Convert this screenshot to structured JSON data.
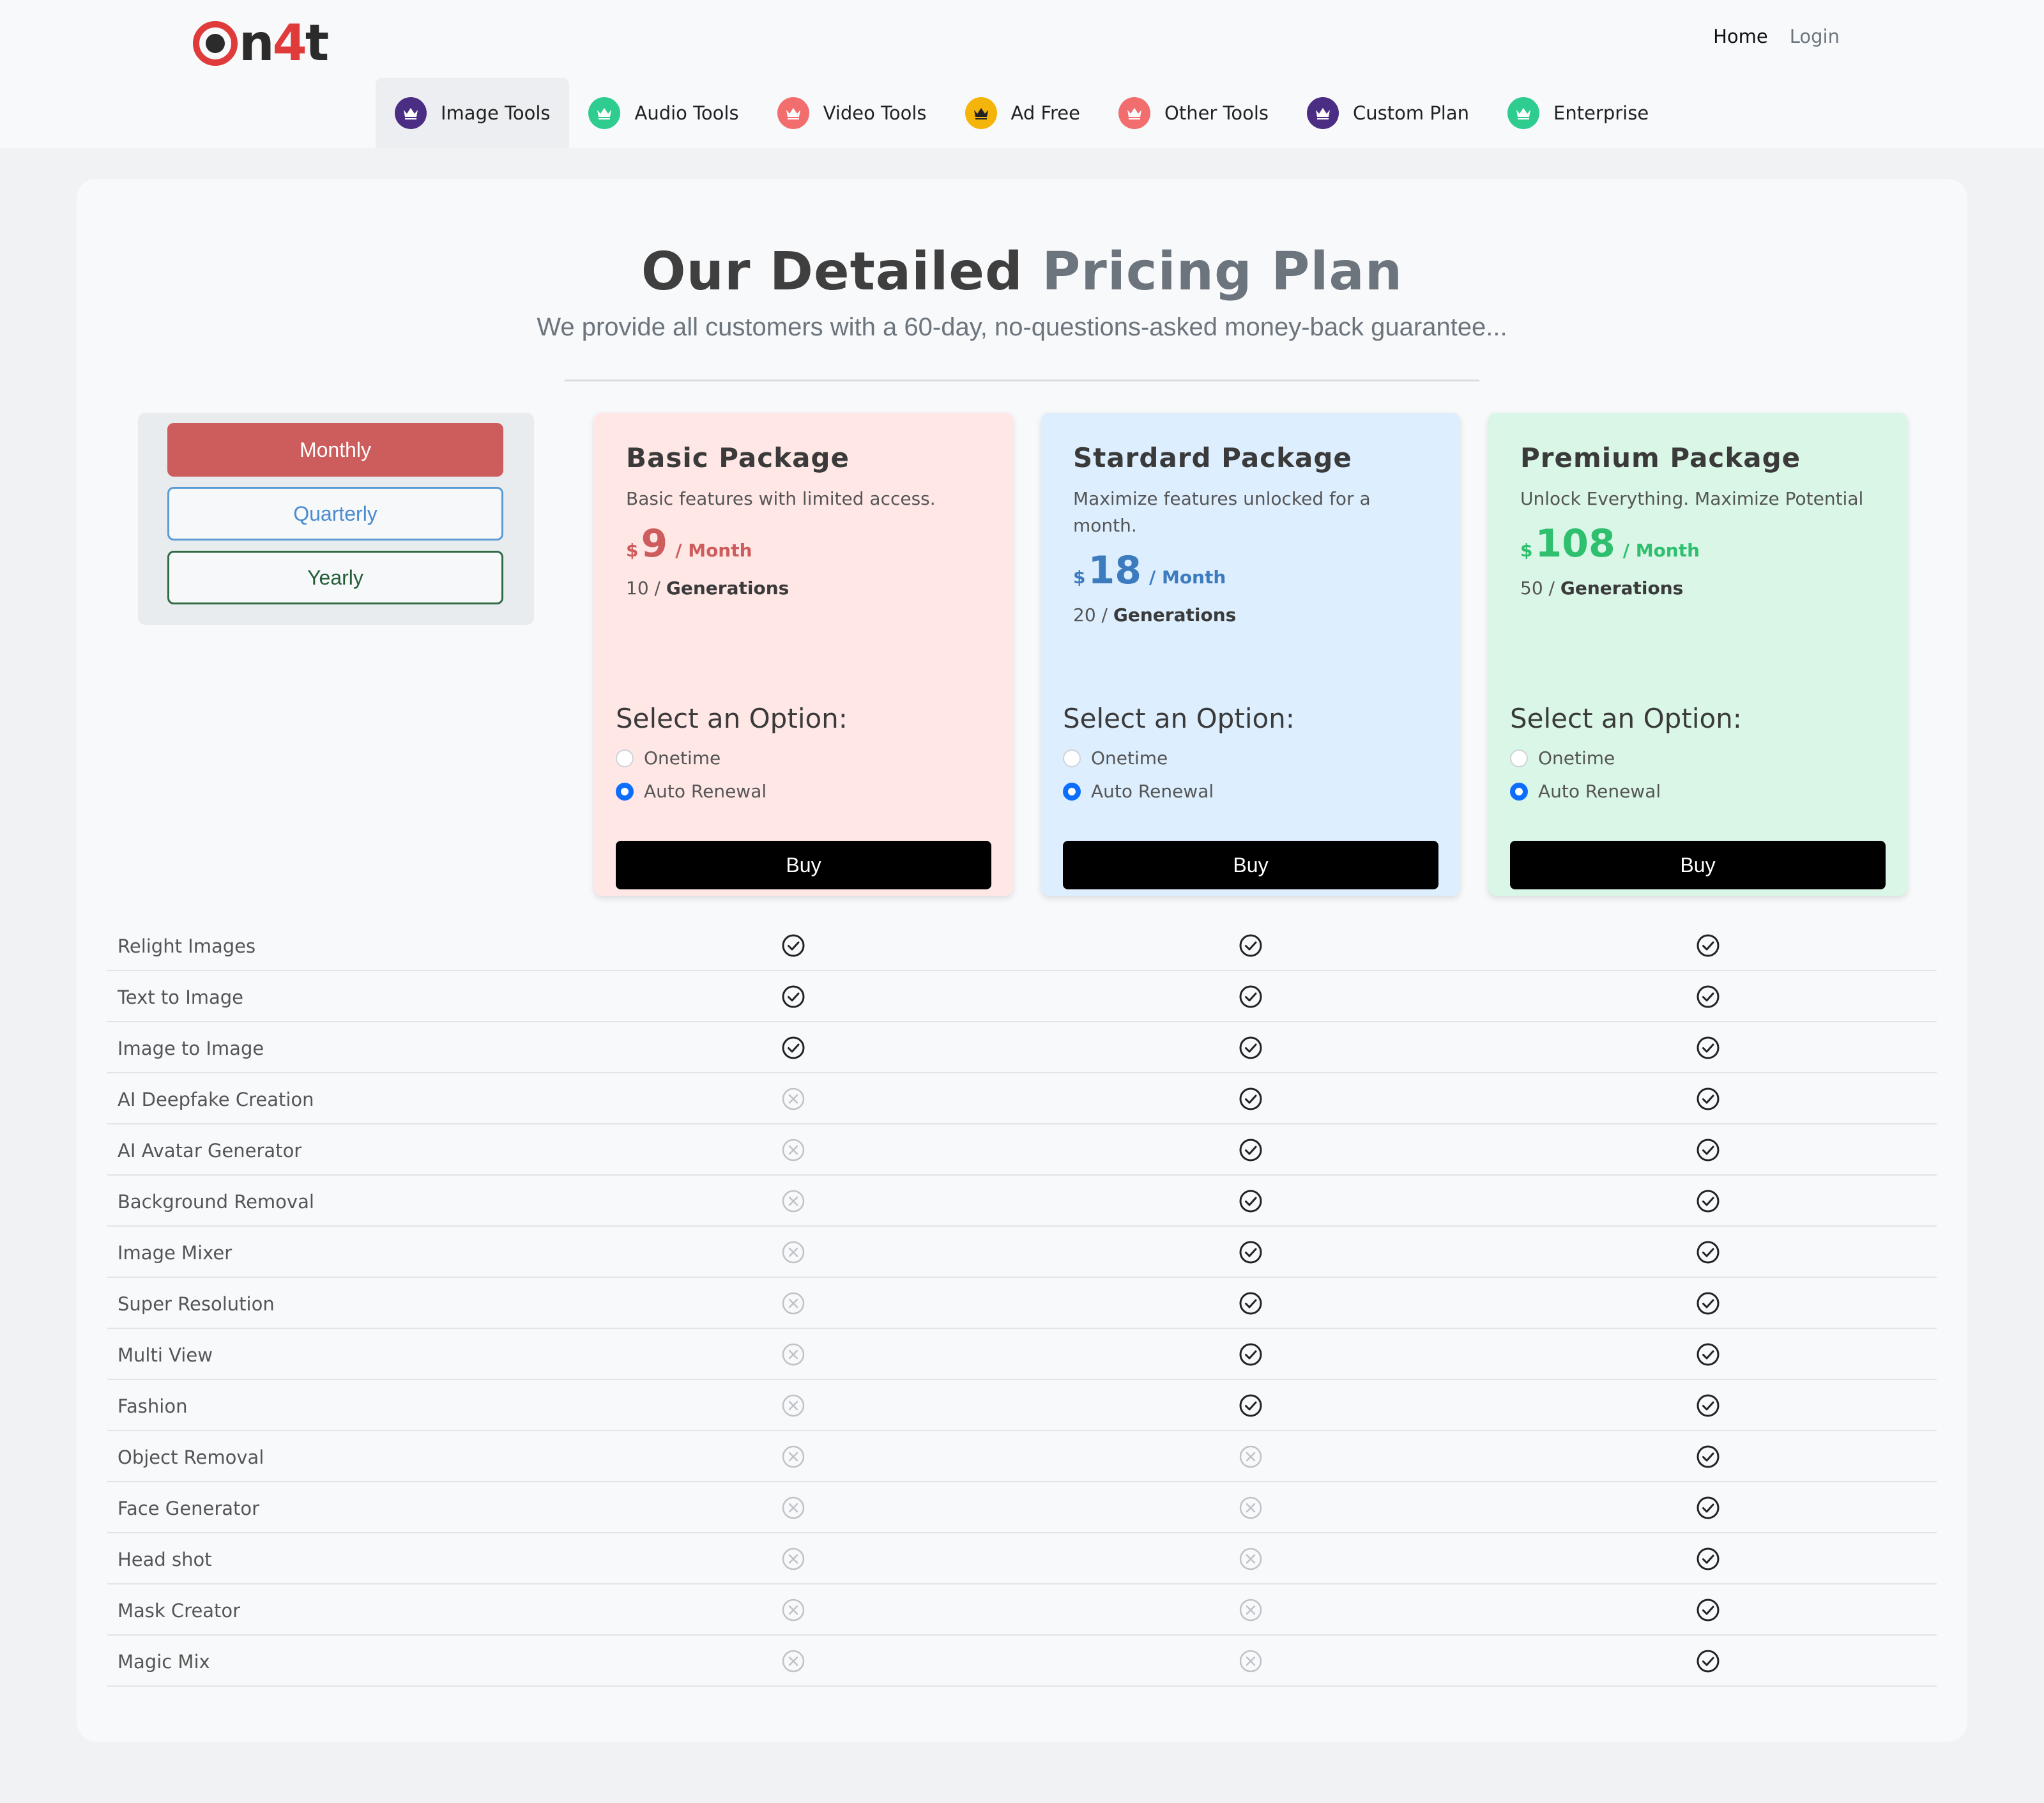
{
  "header": {
    "logo": {
      "prefix": "n",
      "four": "4",
      "suffix": "t"
    },
    "nav": {
      "home": "Home",
      "login": "Login"
    },
    "tabs": [
      {
        "label": "Image Tools",
        "color": "#4b2e83",
        "icon": "crown-icon",
        "active": true
      },
      {
        "label": "Audio Tools",
        "color": "#2ecc8f",
        "icon": "crown-icon"
      },
      {
        "label": "Video Tools",
        "color": "#f26d6d",
        "icon": "crown-icon"
      },
      {
        "label": "Ad Free",
        "color": "#f5b40a",
        "icon": "crown-icon"
      },
      {
        "label": "Other Tools",
        "color": "#f26d6d",
        "icon": "crown-icon"
      },
      {
        "label": "Custom Plan",
        "color": "#4b2e83",
        "icon": "crown-icon"
      },
      {
        "label": "Enterprise",
        "color": "#2ecc8f",
        "icon": "crown-icon"
      }
    ]
  },
  "hero": {
    "title_main": "Our Detailed",
    "title_accent": "Pricing Plan",
    "subtitle": "We provide all customers with a 60-day, no-questions-asked money-back guarantee..."
  },
  "billing": {
    "monthly": "Monthly",
    "quarterly": "Quarterly",
    "yearly": "Yearly",
    "selected": "Monthly"
  },
  "packages": [
    {
      "name": "Basic Package",
      "desc": "Basic features with limited access.",
      "currency": "$",
      "price": "9",
      "period": "/ Month",
      "gen_count": "10 /",
      "gen_label": "Generations",
      "option_title": "Select an Option:",
      "opt1": "Onetime",
      "opt2": "Auto Renewal",
      "buy": "Buy",
      "accent": "#cd5c5c"
    },
    {
      "name": "Stardard Package",
      "desc": "Maximize features unlocked for a month.",
      "currency": "$",
      "price": "18",
      "period": "/ Month",
      "gen_count": "20 /",
      "gen_label": "Generations",
      "option_title": "Select an Option:",
      "opt1": "Onetime",
      "opt2": "Auto Renewal",
      "buy": "Buy",
      "accent": "#3d7bbf"
    },
    {
      "name": "Premium Package",
      "desc": "Unlock Everything. Maximize Potential",
      "currency": "$",
      "price": "108",
      "period": "/ Month",
      "gen_count": "50 /",
      "gen_label": "Generations",
      "option_title": "Select an Option:",
      "opt1": "Onetime",
      "opt2": "Auto Renewal",
      "buy": "Buy",
      "accent": "#2ebf6f"
    }
  ],
  "features": [
    {
      "name": "Relight Images",
      "basic": true,
      "standard": true,
      "premium": true
    },
    {
      "name": "Text to Image",
      "basic": true,
      "standard": true,
      "premium": true
    },
    {
      "name": "Image to Image",
      "basic": true,
      "standard": true,
      "premium": true
    },
    {
      "name": "AI Deepfake Creation",
      "basic": false,
      "standard": true,
      "premium": true
    },
    {
      "name": "AI Avatar Generator",
      "basic": false,
      "standard": true,
      "premium": true
    },
    {
      "name": "Background Removal",
      "basic": false,
      "standard": true,
      "premium": true
    },
    {
      "name": "Image Mixer",
      "basic": false,
      "standard": true,
      "premium": true
    },
    {
      "name": "Super Resolution",
      "basic": false,
      "standard": true,
      "premium": true
    },
    {
      "name": "Multi View",
      "basic": false,
      "standard": true,
      "premium": true
    },
    {
      "name": "Fashion",
      "basic": false,
      "standard": true,
      "premium": true
    },
    {
      "name": "Object Removal",
      "basic": false,
      "standard": false,
      "premium": true
    },
    {
      "name": "Face Generator",
      "basic": false,
      "standard": false,
      "premium": true
    },
    {
      "name": "Head shot",
      "basic": false,
      "standard": false,
      "premium": true
    },
    {
      "name": "Mask Creator",
      "basic": false,
      "standard": false,
      "premium": true
    },
    {
      "name": "Magic Mix",
      "basic": false,
      "standard": false,
      "premium": true
    }
  ]
}
